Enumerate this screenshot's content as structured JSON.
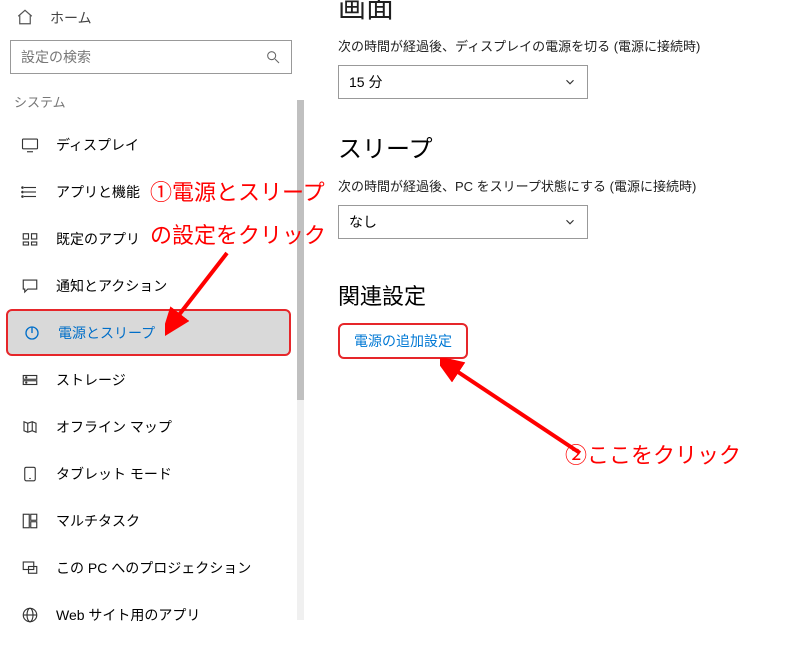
{
  "home_label": "ホーム",
  "search_placeholder": "設定の検索",
  "section_label": "システム",
  "nav": {
    "items": [
      {
        "label": "ディスプレイ"
      },
      {
        "label": "アプリと機能"
      },
      {
        "label": "既定のアプリ"
      },
      {
        "label": "通知とアクション"
      },
      {
        "label": "電源とスリープ"
      },
      {
        "label": "ストレージ"
      },
      {
        "label": "オフライン マップ"
      },
      {
        "label": "タブレット モード"
      },
      {
        "label": "マルチタスク"
      },
      {
        "label": "この PC へのプロジェクション"
      },
      {
        "label": "Web サイト用のアプリ"
      }
    ]
  },
  "main": {
    "heading_cut": "画面",
    "display_off_label": "次の時間が経過後、ディスプレイの電源を切る (電源に接続時)",
    "display_off_value": "15 分",
    "sleep_heading": "スリープ",
    "sleep_label": "次の時間が経過後、PC をスリープ状態にする (電源に接続時)",
    "sleep_value": "なし",
    "related_heading": "関連設定",
    "related_link": "電源の追加設定"
  },
  "annot": {
    "step1_line1": "①電源とスリープ",
    "step1_line2": "の設定をクリック",
    "step2": "②ここをクリック"
  }
}
